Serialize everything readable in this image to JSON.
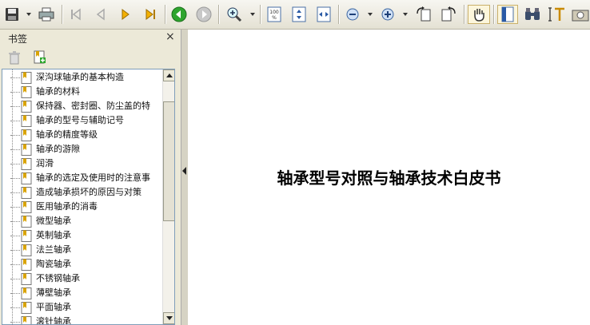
{
  "panel": {
    "title": "书签",
    "close": "×"
  },
  "bookmarks": [
    "深沟球轴承的基本构造",
    "轴承的材料",
    "保持器、密封圈、防尘盖的特",
    "轴承的型号与辅助记号",
    "轴承的精度等级",
    "轴承的游隙",
    "润滑",
    "轴承的选定及使用时的注意事",
    "造成轴承损坏的原因与对策",
    "医用轴承的消毒",
    "微型轴承",
    "英制轴承",
    "法兰轴承",
    "陶瓷轴承",
    "不锈钢轴承",
    "薄壁轴承",
    "平面轴承",
    "滚针轴承"
  ],
  "document": {
    "title": "轴承型号对照与轴承技术白皮书"
  },
  "icons": [
    "save-icon",
    "print-icon",
    "first-page-icon",
    "prev-page-icon",
    "next-page-icon",
    "last-page-icon",
    "back-icon",
    "forward-icon",
    "zoom-in-tool-icon",
    "actual-size-icon",
    "fit-page-icon",
    "fit-width-icon",
    "zoom-out-icon",
    "zoom-in-icon",
    "rotate-left-icon",
    "rotate-right-icon",
    "hand-tool-icon",
    "bookmark-panel-icon",
    "find-icon",
    "text-select-icon",
    "snapshot-icon"
  ]
}
